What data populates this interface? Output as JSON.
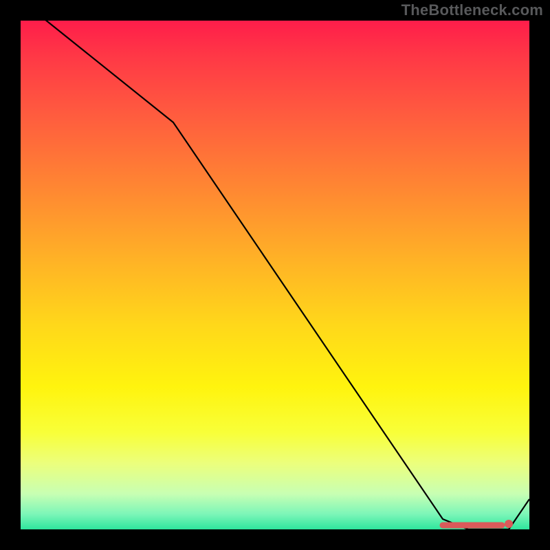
{
  "attribution": "TheBottleneck.com",
  "chart_data": {
    "type": "line",
    "title": "",
    "xlabel": "",
    "ylabel": "",
    "xlim": [
      0,
      100
    ],
    "ylim": [
      0,
      100
    ],
    "grid": false,
    "legend": false,
    "series": [
      {
        "name": "curve",
        "x": [
          0,
          30,
          83,
          88,
          96,
          100
        ],
        "values": [
          104,
          80,
          2,
          0,
          0,
          6
        ]
      }
    ],
    "markers": {
      "highlight_segment": {
        "x_start": 83,
        "x_end": 96,
        "y": 0
      },
      "dot": {
        "x": 96,
        "y": 0
      }
    },
    "colors": {
      "gradient_top": "#ff1d4a",
      "gradient_bottom": "#2ee59d",
      "line": "#000000",
      "marker": "#da5a5a",
      "frame": "#000000"
    }
  }
}
